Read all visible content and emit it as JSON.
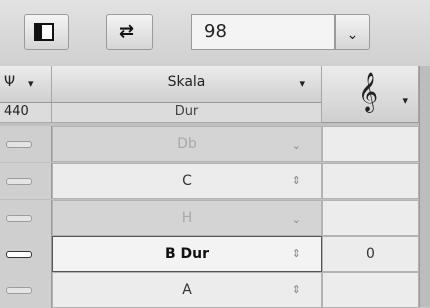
{
  "toolbar": {
    "number_value": "98",
    "dropdown_arrow": "⌄"
  },
  "columns": {
    "tuning_header": "Ψ",
    "tuning_caret": "▾",
    "tuning_value": "440",
    "scale_header": "Skala",
    "scale_caret": "▾",
    "scale_value": "Dur",
    "clef_symbol": "𝄞",
    "clef_caret": "▾"
  },
  "rows": [
    {
      "note": "Db",
      "spin": "⌄",
      "value": ""
    },
    {
      "note": "C",
      "spin": "⇕",
      "value": ""
    },
    {
      "note": "H",
      "spin": "⌄",
      "value": ""
    },
    {
      "note": "B Dur",
      "spin": "⇕",
      "value": "0"
    },
    {
      "note": "A",
      "spin": "⇕",
      "value": ""
    }
  ],
  "icons": {
    "panel": "panel-toggle-icon",
    "transpose": "transpose-icon",
    "clef": "treble-clef-icon"
  }
}
